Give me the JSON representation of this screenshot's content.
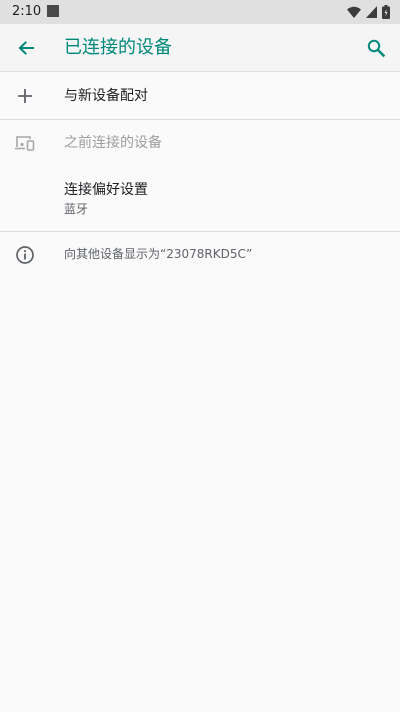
{
  "status_bar": {
    "time": "2:10",
    "icons": [
      "notification-square-icon",
      "wifi-icon",
      "signal-icon",
      "battery-icon"
    ]
  },
  "toolbar": {
    "title": "已连接的设备",
    "back_icon": "back-arrow-icon",
    "search_icon": "search-icon",
    "accent_color": "#00897b"
  },
  "items": {
    "pair_new": {
      "label": "与新设备配对",
      "icon": "plus-icon"
    },
    "previous_devices": {
      "label": "之前连接的设备",
      "icon": "devices-icon"
    },
    "preferences": {
      "label": "连接偏好设置",
      "summary": "蓝牙"
    },
    "visibility_info": {
      "label": "向其他设备显示为“23078RKD5C”",
      "icon": "info-icon"
    }
  }
}
